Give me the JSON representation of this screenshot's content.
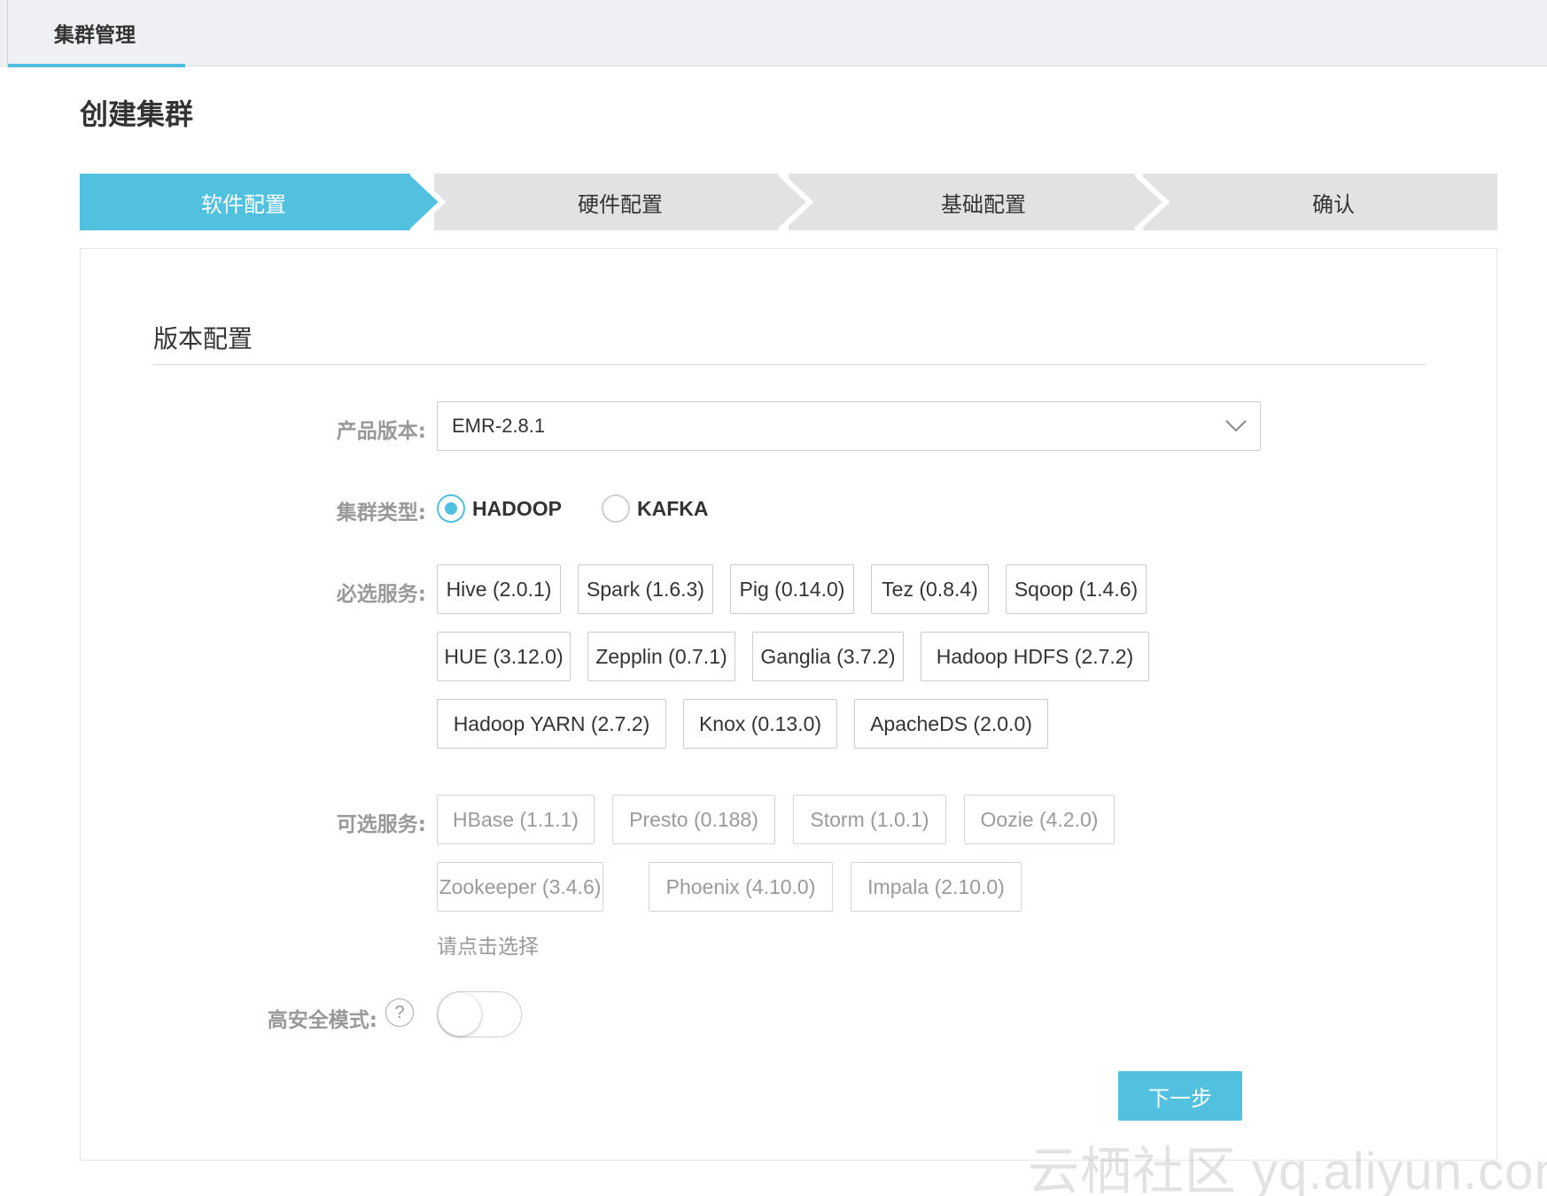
{
  "topbar": {
    "tab_label": "集群管理"
  },
  "page": {
    "title": "创建集群"
  },
  "steps": [
    {
      "label": "软件配置",
      "state": "active"
    },
    {
      "label": "硬件配置",
      "state": "pending"
    },
    {
      "label": "基础配置",
      "state": "pending"
    },
    {
      "label": "确认",
      "state": "pending"
    }
  ],
  "section": {
    "title": "版本配置"
  },
  "form": {
    "product_version": {
      "label": "产品版本:",
      "value": "EMR-2.8.1"
    },
    "cluster_type": {
      "label": "集群类型:",
      "options": [
        {
          "label": "HADOOP",
          "selected": true
        },
        {
          "label": "KAFKA",
          "selected": false
        }
      ]
    },
    "required_services": {
      "label": "必选服务:",
      "items": [
        "Hive (2.0.1)",
        "Spark (1.6.3)",
        "Pig (0.14.0)",
        "Tez (0.8.4)",
        "Sqoop (1.4.6)",
        "HUE (3.12.0)",
        "Zepplin (0.7.1)",
        "Ganglia (3.7.2)",
        "Hadoop HDFS (2.7.2)",
        "Hadoop YARN (2.7.2)",
        "Knox (0.13.0)",
        "ApacheDS (2.0.0)"
      ]
    },
    "optional_services": {
      "label": "可选服务:",
      "items": [
        "HBase (1.1.1)",
        "Presto (0.188)",
        "Storm (1.0.1)",
        "Oozie (4.2.0)",
        "Zookeeper (3.4.6)",
        "Phoenix (4.10.0)",
        "Impala (2.10.0)"
      ],
      "hint": "请点击选择"
    },
    "high_security": {
      "label": "高安全模式:",
      "help": "?",
      "enabled": false
    }
  },
  "actions": {
    "next_label": "下一步"
  },
  "watermark": "云栖社区 yq.aliyun.com",
  "colors": {
    "accent": "#52c0df",
    "step_inactive": "#e2e2e2",
    "label_gray": "#999999"
  }
}
